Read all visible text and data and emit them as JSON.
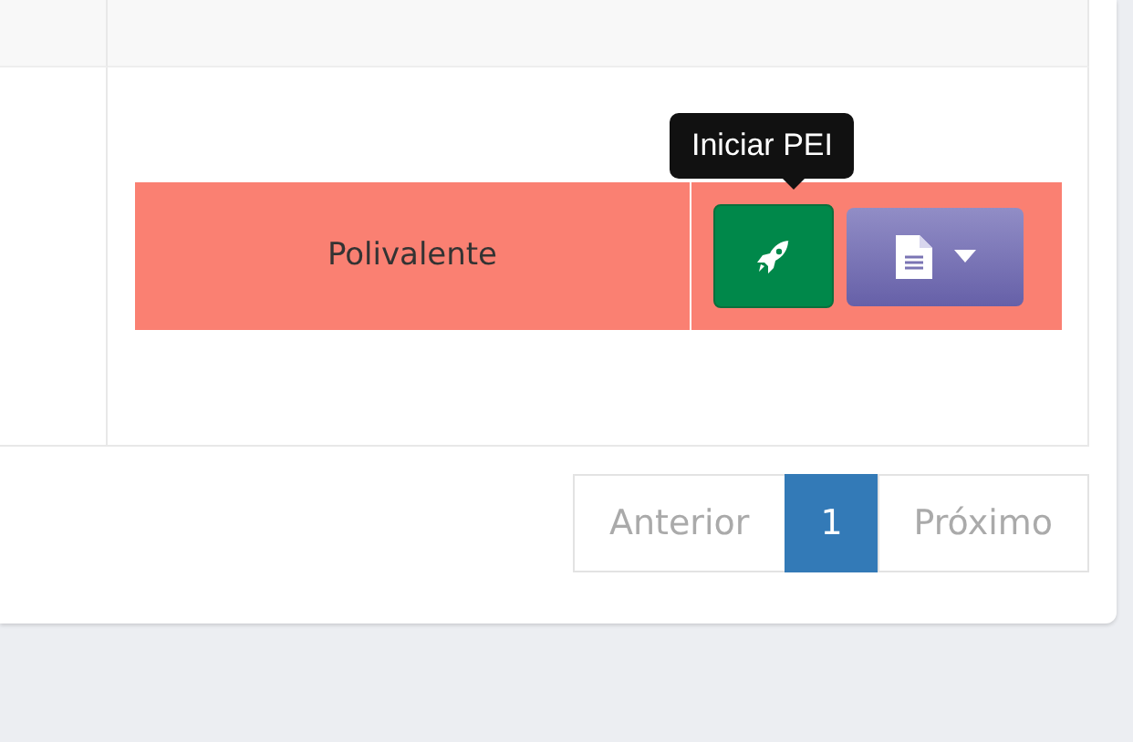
{
  "table": {
    "rows": [
      {
        "highlighted": true,
        "cells": [
          {
            "text": "Polivalente"
          }
        ],
        "actions": [
          {
            "kind": "start",
            "tooltip": "Iniciar PEI"
          },
          {
            "kind": "document-menu"
          }
        ]
      }
    ]
  },
  "pagination": [
    {
      "label": "Anterior",
      "selected": false
    },
    {
      "label": "1",
      "selected": true
    },
    {
      "label": "Próximo",
      "selected": false
    }
  ]
}
